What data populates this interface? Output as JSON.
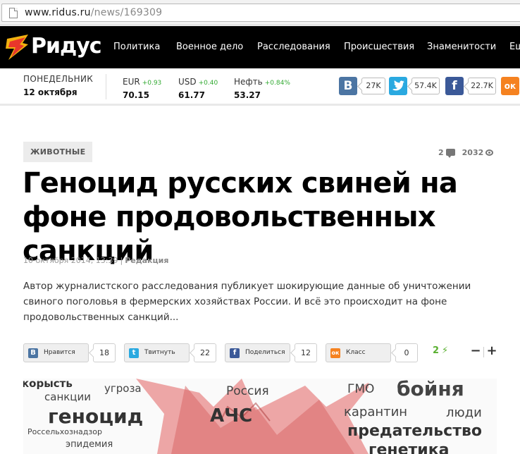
{
  "browser": {
    "url_domain": "www.ridus.ru",
    "url_path": "/news/169309"
  },
  "header": {
    "logo_text": "Ридус",
    "nav": [
      "Политика",
      "Военное дело",
      "Расследования",
      "Происшествия",
      "Знаменитости",
      "Еще"
    ]
  },
  "infobar": {
    "day": "ПОНЕДЕЛЬНИК",
    "date": "12 октября",
    "currencies": [
      {
        "name": "EUR",
        "change": "+0.93",
        "value": "70.15"
      },
      {
        "name": "USD",
        "change": "+0.40",
        "value": "61.77"
      },
      {
        "name": "Нефть",
        "change": "+0.84%",
        "value": "53.27"
      }
    ],
    "social": [
      {
        "icon": "vk-icon",
        "letter": "В",
        "count": "27K",
        "color": "#4c75a3"
      },
      {
        "icon": "twitter-icon",
        "letter": "t",
        "count": "57.4K",
        "color": "#2aa9e0"
      },
      {
        "icon": "facebook-icon",
        "letter": "f",
        "count": "22.7K",
        "color": "#3b5998"
      },
      {
        "icon": "odnoklassniki-icon",
        "letter": "ок",
        "count": "",
        "color": "#f58220"
      }
    ]
  },
  "article": {
    "tag": "ЖИВОТНЫЕ",
    "comments": "2",
    "views": "2032",
    "title": "Геноцид русских свиней на фоне продовольственных санкций",
    "date": "10 октября 2014, 13:39",
    "author": "Редакция",
    "lead": "Автор журналистского расследования публикует шокирующие данные об уничтожении свиного поголовья в фермерских хозяйствах России. И всё это происходит на фоне продовольственных санкций..."
  },
  "share": [
    {
      "icon": "vk-icon",
      "glyph": "В",
      "label": "Нравится",
      "count": "18",
      "color": "#4c75a3"
    },
    {
      "icon": "twitter-icon",
      "glyph": "t",
      "label": "Твитнуть",
      "count": "22",
      "color": "#2aa9e0"
    },
    {
      "icon": "facebook-icon",
      "glyph": "f",
      "label": "Поделиться",
      "count": "12",
      "color": "#3b5998"
    },
    {
      "icon": "odnoklassniki-icon",
      "glyph": "ок",
      "label": "Класс",
      "count": "0",
      "color": "#f58220"
    }
  ],
  "rating": {
    "value": "2",
    "minus": "−",
    "plus": "+"
  },
  "image_words": {
    "w1": "корысть",
    "w2": "угроза",
    "w3": "санкции",
    "w4": "геноцид",
    "w5": "Россельхознадзор",
    "w6": "эпидемия",
    "w7": "Россия",
    "w8": "АЧС",
    "w9": "ГМО",
    "w10": "бойня",
    "w11": "карантин",
    "w12": "люди",
    "w13": "предательство",
    "w14": "генетика"
  }
}
